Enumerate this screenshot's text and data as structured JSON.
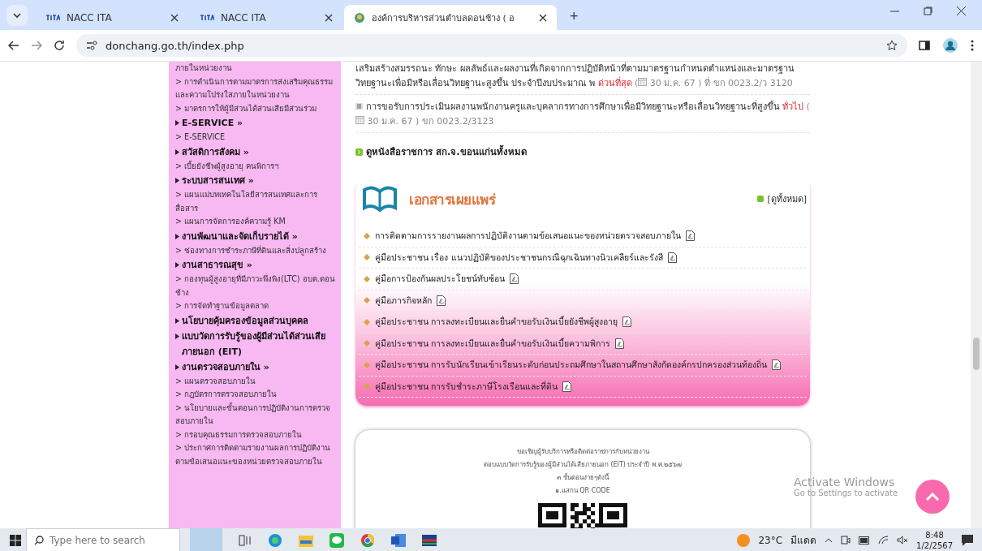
{
  "browser": {
    "tabs": [
      {
        "title": "NACC ITA",
        "selected": false
      },
      {
        "title": "NACC ITA",
        "selected": false
      },
      {
        "title": "องค์การบริหารส่วนตำบลดอนช้าง ( อ",
        "selected": true
      }
    ],
    "new_tab": "+",
    "address": "donchang.go.th/index.php"
  },
  "sidebar": {
    "items": [
      {
        "kind": "text",
        "text": "ภายในหน่วยงาน"
      },
      {
        "kind": "link",
        "text": "> การดำเนินการตามมาตรการส่งเสริมคุณธรรมและความโปร่งใสภายในหน่วยงาน"
      },
      {
        "kind": "link",
        "text": "> มาตรการให้ผู้มีส่วนได้ส่วนเสียมีส่วนร่วม"
      },
      {
        "kind": "heading",
        "text": "E-SERVICE »"
      },
      {
        "kind": "link",
        "text": "> E-SERVICE"
      },
      {
        "kind": "heading",
        "text": "สวัสดิการสังคม »"
      },
      {
        "kind": "link",
        "text": "> เบี้ยยังชีพผู้สูงอายุ คนพิการฯ"
      },
      {
        "kind": "heading",
        "text": "ระบบสารสนเทศ »"
      },
      {
        "kind": "link",
        "text": "> แผนแม่บทเทคโนโลยีสารสนเทศและการสื่อสาร"
      },
      {
        "kind": "link",
        "text": "> แผนการจัดการองค์ความรู้ KM"
      },
      {
        "kind": "heading",
        "text": "งานพัฒนาและจัดเก็บรายได้ »"
      },
      {
        "kind": "link",
        "text": "> ช่องทางการชำระภาษีที่ดินและสิ่งปลูกสร้าง"
      },
      {
        "kind": "heading",
        "text": "งานสาธารณสุข »"
      },
      {
        "kind": "link",
        "text": "> กองทุนผู้สูงอายุที่มีภาวะพึ่งพิง(LTC) อบต.ดอนช้าง"
      },
      {
        "kind": "link",
        "text": "> การจัดทำฐานข้อมูลตลาด"
      },
      {
        "kind": "heading",
        "text": "นโยบายคุ้มครองข้อมูลส่วนบุคคล"
      },
      {
        "kind": "heading",
        "text": "แบบวัดการรับรู้ของผู้มีส่วนได้ส่วนเสียภายนอก (EIT)"
      },
      {
        "kind": "heading",
        "text": "งานตรวจสอบภายใน »"
      },
      {
        "kind": "link",
        "text": "> แผนตรวจสอบภายใน"
      },
      {
        "kind": "link",
        "text": "> กฎบัตรการตรวจสอบภายใน"
      },
      {
        "kind": "link",
        "text": "> นโยบายและขั้นตอนการปฏิบัติงานการตรวจสอบภายใน"
      },
      {
        "kind": "link",
        "text": "> กรอบคุณธรรมการตรวจสอบภายใน"
      },
      {
        "kind": "link",
        "text": "> ประกาศการติดตามรายงานผลการปฏิบัติงานตามข้อเสนอแนะของหน่วยตรวจสอบภายใน"
      }
    ]
  },
  "notices": [
    {
      "kind": "continued",
      "text": "เสริมสร้างสมรรถนะ ทักษะ ผลลัพธ์และผลงานที่เกิดจากการปฏิบัติหน้าที่ตามมาตรฐานกำหนดตำแหน่งและมาตรฐานวิทยฐานะเพื่อมีหรือเลื่อนวิทยฐานะสูงขึ้น ประจำปีงบประมาณ พ",
      "tag": "ด่วนที่สุด",
      "open": "(",
      "meta": "30 ม.ค. 67 ) ที่ ขก 0023.2/ว 3120"
    },
    {
      "kind": "notice",
      "text": "การขอรับการประเมินผลงานพนักงานครูและบุคลากรทางการศึกษาเพื่อมีวิทยฐานะหรือเลื่อนวิทยฐานะที่สูงขึ้น",
      "tag": "ทั่วไป",
      "open": "(",
      "meta": "30 ม.ค. 67 ) ขก 0023.2/3123"
    }
  ],
  "notices_link": "ดูหนังสือราชการ สก.จ.ขอนแก่นทั้งหมด",
  "documents": {
    "title": "เอกสารเผยแพร่",
    "view_all": "[ดูทั้งหมด]",
    "items": [
      "การติดตามการรายงานผลการปฏิบัติงานตามข้อเสนอแนะของหน่วยตรวจสอบภายใน",
      "คู่มือประชาชน เรื่อง แนวปฏิบัติของประชาชนกรณีฉุกเฉินทางนิวเคลียร์และรังสี",
      "คู่มือการป้องกันผลประโยชน์ทับซ้อน",
      "คู่มือภารกิจหลัก",
      "คู่มือประชาชน การลงทะเบียนและยื่นคำขอรับเงินเบี้ยยังชีพผู้สูงอายุ",
      "คู่มือประชาชน การลงทะเบียนและยื่นคำขอรับเงินเบี้ยความพิการ",
      "คู่มือประชาชน การรับนักเรียนเข้าเรียนระดับก่อนประถมศึกษาในสถานศึกษาสังกัดองค์กรปกครองส่วนท้องถิ่น",
      "คู่มือประชาชน การรับชำระภาษีโรงเรือนและที่ดิน"
    ]
  },
  "survey_card": {
    "lines": [
      "ขอเชิญผู้รับบริการหรือติดต่อราชการกับหน่วยงาน",
      "ตอบแบบวัดการรับรู้ของผู้มีส่วนได้เสียภายนอก (EIT) ประจำปี พ.ศ.๒๕๖๗",
      "๓ ขั้นตอนง่ายๆดังนี้",
      "๑.แสกน QR CODE"
    ]
  },
  "activation_notice": {
    "title": "Activate Windows",
    "subtitle": "Go to Settings to activate"
  },
  "taskbar": {
    "search_placeholder": "Type here to search",
    "temperature": "23°C",
    "weather": "มีแดด",
    "time": "8:48",
    "date": "1/2/2567"
  }
}
